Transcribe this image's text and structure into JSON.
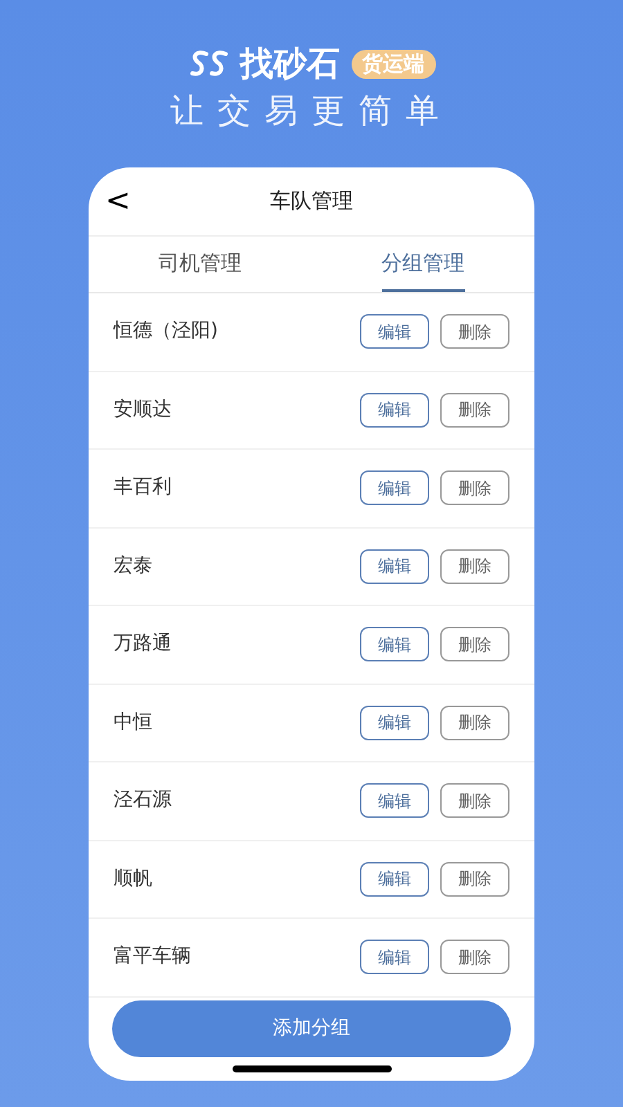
{
  "brand": {
    "name": "找砂石",
    "badge": "货运端",
    "tagline": "让交易更简单"
  },
  "nav": {
    "back": "<",
    "title": "车队管理"
  },
  "tabs": [
    {
      "label": "司机管理",
      "selected": false
    },
    {
      "label": "分组管理",
      "selected": true
    }
  ],
  "groups": [
    {
      "name": "恒德（泾阳)",
      "edit": "编辑",
      "delete": "删除"
    },
    {
      "name": "安顺达",
      "edit": "编辑",
      "delete": "删除"
    },
    {
      "name": "丰百利",
      "edit": "编辑",
      "delete": "删除"
    },
    {
      "name": "宏泰",
      "edit": "编辑",
      "delete": "删除"
    },
    {
      "name": "万路通",
      "edit": "编辑",
      "delete": "删除"
    },
    {
      "name": "中恒",
      "edit": "编辑",
      "delete": "删除"
    },
    {
      "name": "泾石源",
      "edit": "编辑",
      "delete": "删除"
    },
    {
      "name": "顺帆",
      "edit": "编辑",
      "delete": "删除"
    },
    {
      "name": "富平车辆",
      "edit": "编辑",
      "delete": "删除"
    }
  ],
  "add_button": "添加分组"
}
